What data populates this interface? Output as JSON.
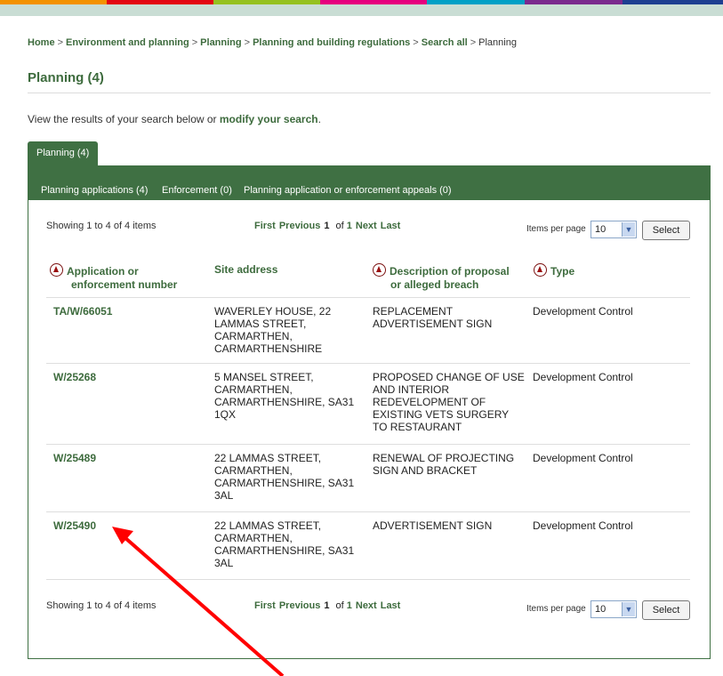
{
  "colors": {
    "accent_green": "#3f7043",
    "link_green": "#3d6b3d",
    "sort_icon_red": "#9b1111",
    "annotation_arrow": "#ff0000"
  },
  "breadcrumb": [
    {
      "label": "Home"
    },
    {
      "label": "Environment and planning"
    },
    {
      "label": "Planning"
    },
    {
      "label": "Planning and building regulations"
    },
    {
      "label": "Search all"
    },
    {
      "label": "Planning"
    }
  ],
  "breadcrumb_sep": ">",
  "page_title": "Planning (4)",
  "intro": {
    "text": "View the results of your search below or ",
    "link": "modify your search",
    "end": "."
  },
  "tab": {
    "label": "Planning (4)"
  },
  "subnav": [
    {
      "label": "Planning applications (4)"
    },
    {
      "label": "Enforcement (0)"
    },
    {
      "label": "Planning application or enforcement appeals (0)"
    }
  ],
  "pager": {
    "showing": "Showing 1 to 4 of 4 items",
    "first": "First",
    "previous": "Previous",
    "current": "1",
    "of": "of",
    "total": "1",
    "next": "Next",
    "last": "Last",
    "items_per_page_label": "Items per page",
    "items_per_page_value": "10",
    "select_button": "Select"
  },
  "table": {
    "headers": {
      "number_line1": "Application or",
      "number_line2": "enforcement number",
      "address": "Site address",
      "desc_line1": "Description of proposal",
      "desc_line2": "or alleged breach",
      "type": "Type"
    },
    "rows": [
      {
        "number": "TA/W/66051",
        "address": "WAVERLEY HOUSE, 22 LAMMAS STREET, CARMARTHEN, CARMARTHENSHIRE",
        "description": "REPLACEMENT ADVERTISEMENT SIGN",
        "type": "Development Control"
      },
      {
        "number": "W/25268",
        "address": "5 MANSEL STREET, CARMARTHEN, CARMARTHENSHIRE, SA31 1QX",
        "description": "PROPOSED CHANGE OF USE AND INTERIOR REDEVELOPMENT OF EXISTING VETS SURGERY TO RESTAURANT",
        "type": "Development Control"
      },
      {
        "number": "W/25489",
        "address": "22 LAMMAS STREET, CARMARTHEN, CARMARTHENSHIRE, SA31 3AL",
        "description": "RENEWAL OF PROJECTING SIGN AND BRACKET",
        "type": "Development Control"
      },
      {
        "number": "W/25490",
        "address": "22 LAMMAS STREET, CARMARTHEN, CARMARTHENSHIRE, SA31 3AL",
        "description": "ADVERTISEMENT SIGN",
        "type": "Development Control"
      }
    ]
  }
}
